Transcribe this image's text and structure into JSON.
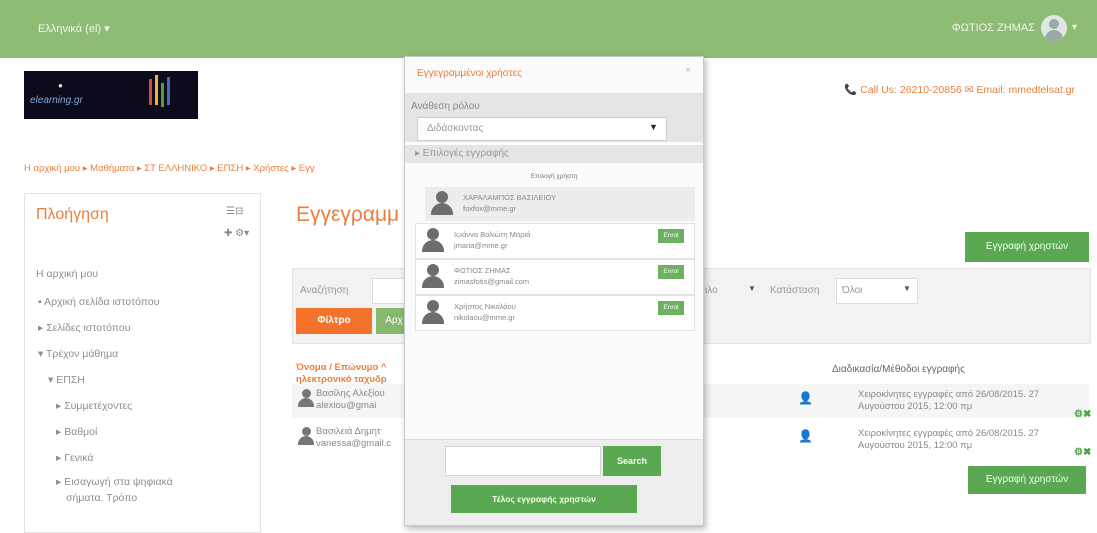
{
  "topbar": {
    "language": "Ελληνικά (el) ▾",
    "user_name": "ΦΩΤΙΟΣ ΖΗΜΑΣ",
    "avatar_caret": "▾"
  },
  "header": {
    "logo_text": "elearning.gr",
    "contact": "📞 Call Us: 26210-20856  ✉ Email: mmedtelsat.gr"
  },
  "breadcrumb": "Η αρχική μου ▸ Μαθήματα ▸ ΣΤ ΕΛΛΗΝΙΚΟ ▸ ΕΠΣΗ ▸ Χρήστες ▸ Εγγ",
  "nav": {
    "title": "Πλοήγηση",
    "tools_icon": "☰⊟",
    "add_icon": "✚ ⚙▾",
    "items": [
      "Η αρχική μου",
      "▪ Αρχική σελίδα ιστοτόπου",
      "▸ Σελίδες ιστοτόπου",
      "▾ Τρέχον μάθημα",
      "▾ ΕΠΣΗ",
      "▸ Συμμετέχοντες",
      "▸ Βαθμοί",
      "▸ Γενικά",
      "▸ Εισαγωγή στα ψηφιακά",
      "σήματα. Τρόπο"
    ]
  },
  "main": {
    "title": "Εγγεγραμμ",
    "enrol_users_button": "Εγγραφή χρηστών",
    "filter": {
      "search_label": "Αναζήτηση",
      "role_tail": "ιλο",
      "status_label": "Κατάσταση",
      "status_value": "Όλοι",
      "filter_button": "Φίλτρο",
      "apply_button": "Αρχ"
    },
    "columns": {
      "name": "Όνομα / Επώνυμο ^",
      "email": "ηλεκτρονικό ταχυδρ",
      "methods": "Διαδικασία/Μέθοδοι εγγραφής"
    },
    "rows": [
      {
        "name": "Βασίλης Αλεξίου",
        "email": "alexiou@gmai",
        "method": "Χειροκίνητες εγγραφές από 26/08/2015. 27",
        "date": "Αυγούστου 2015, 12:00 πμ",
        "actions": "⚙✖"
      },
      {
        "name": "Βασιλειά Δημητ",
        "email": "vanessa@gmail.c",
        "method": "Χειροκίνητες εγγραφές από 26/08/2015. 27",
        "date": "Αυγούστου 2015, 12:00 πμ",
        "actions": "⚙✖"
      }
    ]
  },
  "modal": {
    "title": "Εγγεγραμμένοι χρήστες",
    "close": "×",
    "role_label": "Ανάθεση ρόλου",
    "role_value": "Διδάσκοντας",
    "options_link": "▸ Επιλογές εγγραφής",
    "list_caption": "Επιλογή χρήστη",
    "users": [
      {
        "name": "ΧΑΡΑΛΑΜΠΟΣ ΒΑΣΙΛΕΙΟΥ",
        "email": "foxfox@mme.gr",
        "enrol": ""
      },
      {
        "name": "Ιωάννα Βολιώτη Μαριά",
        "email": "jmaria@mme.gr",
        "enrol": "Enrol"
      },
      {
        "name": "ΦΩΤΙΟΣ ΖΗΜΑΣ",
        "email": "zimasfotis@gmail.com",
        "enrol": "Enrol"
      },
      {
        "name": "Χρήστος Νικολάου",
        "email": "nikolaou@mme.gr",
        "enrol": "Enrol"
      }
    ],
    "search_button": "Search",
    "finish_button": "Τέλος εγγραφής χρηστών"
  }
}
